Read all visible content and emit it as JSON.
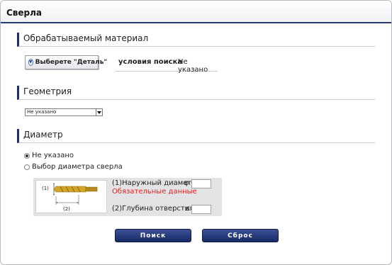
{
  "window": {
    "title": "Сверла"
  },
  "material_section": {
    "heading": "Обрабатываемый материал",
    "select_part_label": "Выберете \"Деталь\"",
    "search_conditions_label": "условия поиска",
    "search_conditions_value": "Не указано"
  },
  "geometry_section": {
    "heading": "Геометрия",
    "select_value": "Не указано"
  },
  "diameter_section": {
    "heading": "Диаметр",
    "options": [
      {
        "label": "Не указано",
        "selected": true
      },
      {
        "label": "Выбор диаметра сверла",
        "selected": false
      }
    ],
    "diagram_label_1": "(1)",
    "diagram_label_2": "(2)",
    "outer_diameter_label": "(1)Наружный диаметр",
    "outer_diameter_symbol": "φ",
    "required_note": "Обязательные данные",
    "hole_depth_label": "(2)Глубина отверстия",
    "hole_depth_symbol": "≤"
  },
  "actions": {
    "search_label": "Поиск",
    "reset_label": "Сброс"
  },
  "colors": {
    "accent": "#1c2c6e",
    "required": "#e02020",
    "drill_gold": "#d4a626"
  }
}
